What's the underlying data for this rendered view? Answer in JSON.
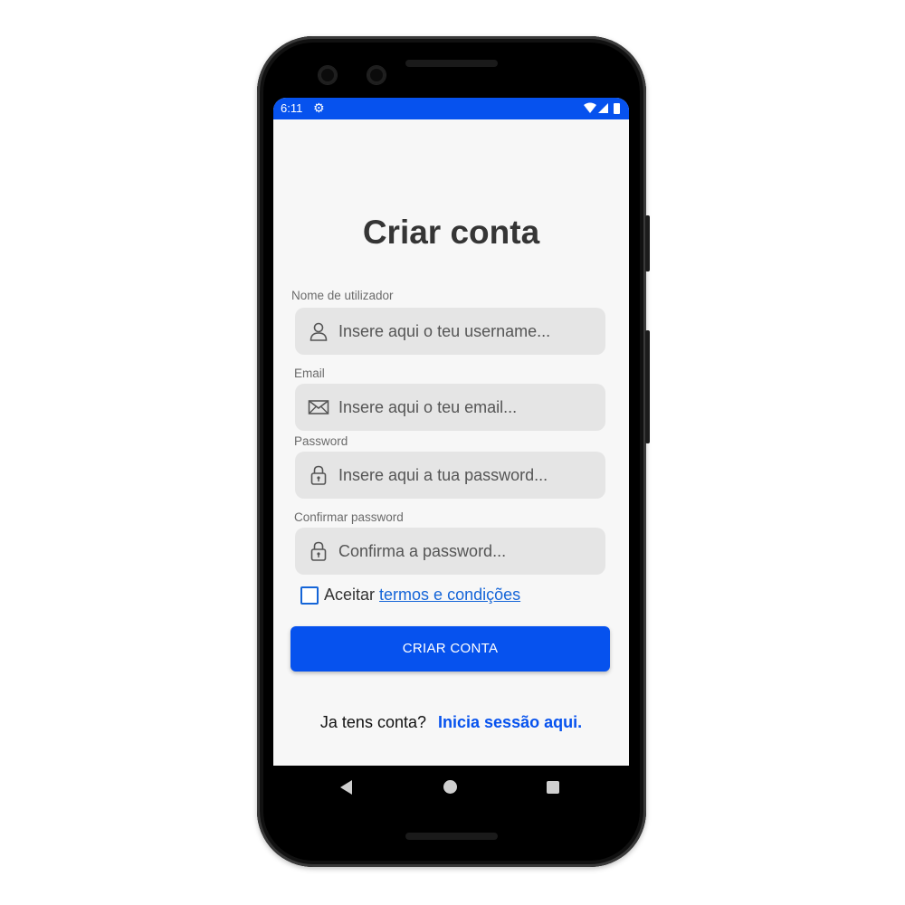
{
  "status_bar": {
    "time": "6:11",
    "gear_icon": "gear-icon",
    "color": "#0652ee"
  },
  "title": "Criar conta",
  "fields": [
    {
      "label": "Nome de utilizador",
      "placeholder": "Insere aqui o teu username...",
      "icon": "user-icon"
    },
    {
      "label": "Email",
      "placeholder": "Insere aqui o teu email...",
      "icon": "envelope-icon"
    },
    {
      "label": "Password",
      "placeholder": "Insere aqui a tua password...",
      "icon": "lock-icon"
    },
    {
      "label": "Confirmar password",
      "placeholder": "Confirma a password...",
      "icon": "lock-icon"
    }
  ],
  "terms": {
    "prefix": "Aceitar",
    "link": "termos e condições",
    "checked": false
  },
  "create_button": "CRIAR CONTA",
  "login": {
    "question": "Ja tens conta?",
    "link": "Inicia sessão aqui."
  },
  "colors": {
    "accent": "#0652ee",
    "link": "#1565d8",
    "field_bg": "#e5e5e5",
    "screen_bg": "#f7f7f7"
  }
}
